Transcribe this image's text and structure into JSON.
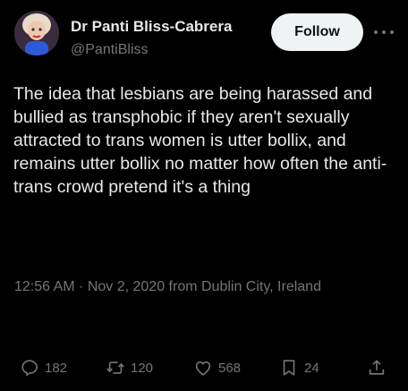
{
  "author": {
    "name": "Dr Panti Bliss-Cabrera",
    "handle": "@PantiBliss"
  },
  "follow_label": "Follow",
  "tweet_text": "The idea that lesbians are being harassed and bullied as transphobic if they aren't sexually attracted to trans women is utter bollix, and remains utter bollix no matter how often the anti-trans crowd pretend it's a thing",
  "meta": "12:56 AM · Nov 2, 2020 from Dublin City, Ireland",
  "actions": {
    "replies": "182",
    "reposts": "120",
    "likes": "568",
    "bookmarks": "24"
  },
  "colors": {
    "background": "#000000",
    "text": "#e7e9ea",
    "muted": "#71767b",
    "follow_bg": "#eff3f4"
  },
  "icons": [
    "avatar",
    "more-icon",
    "reply-icon",
    "repost-icon",
    "like-icon",
    "bookmark-icon",
    "share-icon"
  ]
}
